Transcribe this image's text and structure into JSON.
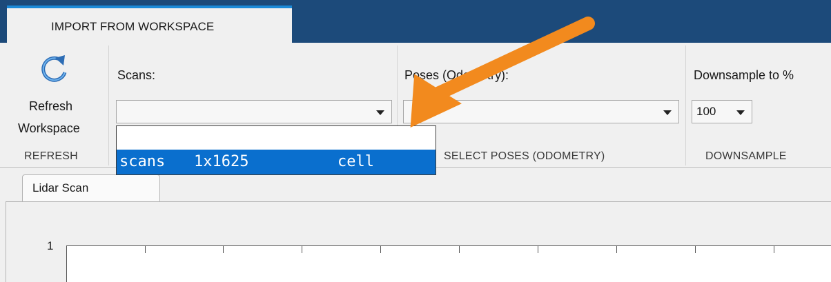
{
  "tabs": {
    "import_label": "IMPORT FROM WORKSPACE"
  },
  "refresh": {
    "label_line1": "Refresh",
    "label_line2": "Workspace",
    "section": "REFRESH"
  },
  "scans": {
    "label": "Scans:",
    "value": "",
    "section": ""
  },
  "poses": {
    "label": "Poses (Odometry):",
    "value": "",
    "section": "SELECT POSES (ODOMETRY)"
  },
  "downsample": {
    "label": "Downsample to %",
    "value": "100",
    "section": "DOWNSAMPLE"
  },
  "dropdown": {
    "items": [
      {
        "name": "",
        "size": "",
        "class": ""
      },
      {
        "name": "scans",
        "size": "1x1625",
        "class": "cell",
        "selected": true
      }
    ]
  },
  "plot": {
    "tab_label": "Lidar Scan",
    "y_tick_top": "1"
  },
  "icons": {
    "refresh": "refresh-icon",
    "annotation": "orange-arrow"
  },
  "colors": {
    "titlebar": "#1c4a7a",
    "tab_accent": "#1b8ad8",
    "selection": "#0a6fce",
    "annotation_arrow": "#f28a1e"
  }
}
